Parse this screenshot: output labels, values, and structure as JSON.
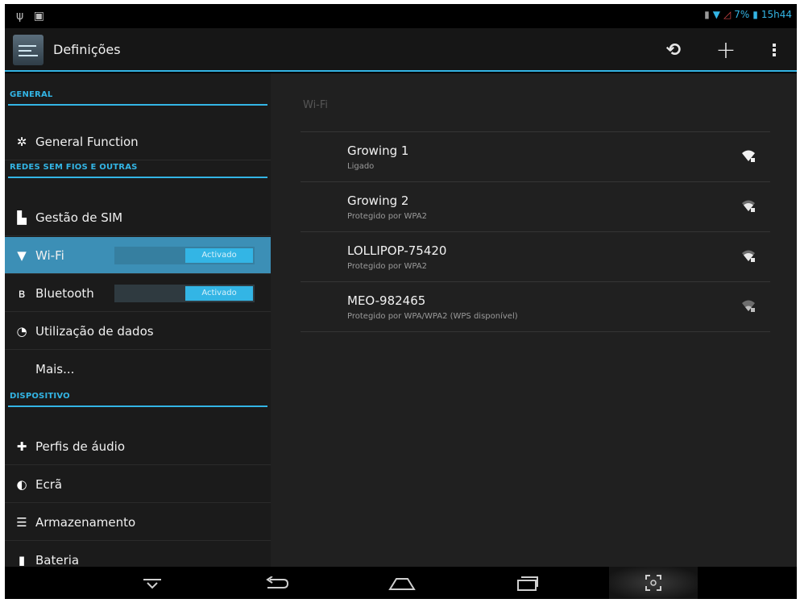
{
  "status_bar": {
    "left_icons": [
      "usb-icon",
      "image-icon"
    ],
    "battery_percent": "7%",
    "time": "15h44"
  },
  "action_bar": {
    "title": "Definições",
    "icons": [
      "settings-app-icon",
      "sync-icon",
      "add-icon",
      "overflow-menu-icon"
    ]
  },
  "sidebar": {
    "sections": [
      {
        "header": "GENERAL",
        "items": [
          {
            "label": "General Function",
            "icon": "gear-icon"
          }
        ]
      },
      {
        "header": "REDES SEM FIOS E OUTRAS",
        "items": [
          {
            "label": "Gestão de SIM",
            "icon": "sim-icon"
          },
          {
            "label": "Wi-Fi",
            "icon": "wifi-icon",
            "toggle": "Activado",
            "active": true
          },
          {
            "label": "Bluetooth",
            "icon": "bluetooth-icon",
            "toggle": "Activado"
          },
          {
            "label": "Utilização de dados",
            "icon": "data-usage-icon"
          },
          {
            "label": "Mais...",
            "icon": ""
          }
        ]
      },
      {
        "header": "DISPOSITIVO",
        "items": [
          {
            "label": "Perfis de áudio",
            "icon": "audio-profile-icon"
          },
          {
            "label": "Ecrã",
            "icon": "display-icon"
          },
          {
            "label": "Armazenamento",
            "icon": "storage-icon"
          },
          {
            "label": "Bateria",
            "icon": "battery-icon"
          }
        ]
      }
    ]
  },
  "wifi_panel": {
    "title": "Wi-Fi",
    "networks": [
      {
        "name": "Growing 1",
        "status": "Ligado",
        "signal": "strong"
      },
      {
        "name": "Growing 2",
        "status": "Protegido por WPA2",
        "signal": "medium"
      },
      {
        "name": "LOLLIPOP-75420",
        "status": "Protegido por WPA2",
        "signal": "medium"
      },
      {
        "name": "MEO-982465",
        "status": "Protegido por WPA/WPA2 (WPS disponível)",
        "signal": "weak"
      }
    ]
  },
  "nav_bar": {
    "icons": [
      "hide-keyboard-icon",
      "back-icon",
      "home-icon",
      "recent-apps-icon",
      "screenshot-icon"
    ]
  },
  "colors": {
    "accent": "#33b5e5",
    "active_row": "#3c8fb6",
    "background": "#202020"
  }
}
